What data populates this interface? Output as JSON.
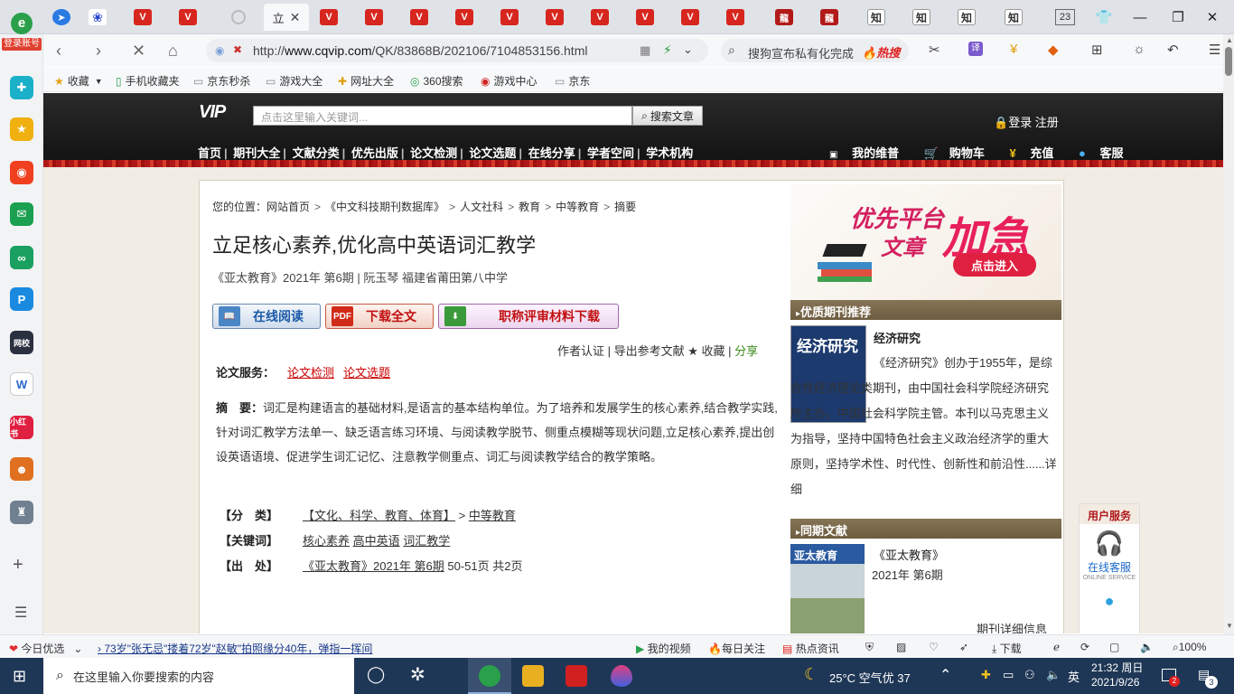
{
  "browser": {
    "tabs": [
      {
        "icon": "compass"
      },
      {
        "icon": "baidu"
      },
      {
        "icon": "cqvip"
      },
      {
        "icon": "cqvip"
      },
      {
        "icon": "loading",
        "label": "立",
        "active": true
      },
      {
        "icon": "cqvip"
      },
      {
        "icon": "cqvip"
      },
      {
        "icon": "cqvip"
      },
      {
        "icon": "cqvip"
      },
      {
        "icon": "cqvip"
      },
      {
        "icon": "cqvip"
      },
      {
        "icon": "cqvip"
      },
      {
        "icon": "cqvip"
      },
      {
        "icon": "cqvip"
      },
      {
        "icon": "cqvip"
      },
      {
        "icon": "cqvip"
      },
      {
        "icon": "dark"
      },
      {
        "icon": "dark"
      },
      {
        "icon": "zhihu",
        "label": "知"
      },
      {
        "icon": "zhihu",
        "label": "知"
      },
      {
        "icon": "zhihu",
        "label": "知"
      },
      {
        "icon": "zhihu",
        "label": "知"
      }
    ],
    "tab_count": "23",
    "url_prefix": "http://",
    "url_host": "www.cqvip.com",
    "url_path": "/QK/83868B/202106/7104853156.html",
    "search_text": "搜狗宣布私有化完成",
    "hot_search": "热搜",
    "login_label": "登录账号",
    "bookmarks": [
      "收藏",
      "手机收藏夹",
      "京东秒杀",
      "游戏大全",
      "网址大全",
      "360搜索",
      "游戏中心",
      "京东"
    ]
  },
  "site": {
    "logo": "VIP",
    "search_placeholder": "点击这里输入关键词...",
    "search_button": "搜索文章",
    "login": "登录 注册",
    "nav": [
      "首页",
      "期刊大全",
      "文献分类",
      "优先出版",
      "论文检测",
      "论文选题",
      "在线分享",
      "学者空间",
      "学术机构"
    ],
    "user_nav": [
      "我的维普",
      "购物车",
      "充值",
      "客服"
    ]
  },
  "article": {
    "breadcrumb_prefix": "您的位置：",
    "breadcrumb": [
      "网站首页",
      "《中文科技期刊数据库》",
      "人文社科",
      "教育",
      "中等教育",
      "摘要"
    ],
    "title": "立足核心素养,优化高中英语词汇教学",
    "meta": "《亚太教育》2021年 第6期 | 阮玉琴   福建省莆田第八中学",
    "buttons": {
      "read": "在线阅读",
      "download": "下载全文",
      "title_material": "职称评审材料下载"
    },
    "actions": {
      "author": "作者认证",
      "sep": " | ",
      "export": "导出参考文献",
      "fav": " ★ 收藏",
      "share": "分享"
    },
    "services_label": "论文服务：",
    "services": [
      "论文检测",
      "论文选题"
    ],
    "abstract_label": "摘　要：",
    "abstract": "词汇是构建语言的基础材料,是语言的基本结构单位。为了培养和发展学生的核心素养,结合教学实践,针对词汇教学方法单一、缺乏语言练习环境、与阅读教学脱节、侧重点模糊等现状问题,立足核心素养,提出创设英语语境、促进学生词汇记忆、注意教学侧重点、词汇与阅读教学结合的教学策略。",
    "fields": [
      {
        "label": "【分　类】",
        "links": [
          "【文化、科学、教育、体育】"
        ],
        "sep": " > ",
        "links2": [
          "中等教育"
        ],
        "extra": ""
      },
      {
        "label": "【关键词】",
        "links": [
          "核心素养",
          "高中英语",
          "词汇教学"
        ],
        "sep": "",
        "links2": [],
        "extra": ""
      },
      {
        "label": "【出　处】",
        "links": [
          "《亚太教育》2021年 第6期"
        ],
        "sep": "",
        "links2": [],
        "extra": " 50-51页 共2页"
      }
    ]
  },
  "sidebar": {
    "ad": {
      "line1": "优先平台",
      "line2": "文章",
      "big": "加急",
      "button": "点击进入"
    },
    "featured_head": "优质期刊推荐",
    "featured_cover_title": "经济研究",
    "featured_name": "经济研究",
    "featured_desc": "《经济研究》创办于1955年，是综合性经济理论类期刊，由中国社会科学院经济研究所主办，中国社会科学院主管。本刊以马克思主义为指导，坚持中国特色社会主义政治经济学的重大原则，坚持学术性、时代性、创新性和前沿性......详细",
    "same_head": "同期文献",
    "same_cover_title": "亚太教育",
    "same_name": "《亚太教育》",
    "same_issue": "2021年 第6期",
    "same_more": "期刊详细信息",
    "usersvc_head": "用户服务",
    "usersvc_label": "在线客服",
    "usersvc_sub": "ONLINE SERVICE"
  },
  "statusbar": {
    "today": "今日优选",
    "news": "73岁\"张无忌\"搂着72岁\"赵敏\"拍照缘分40年，弹指一挥间",
    "video": "我的视频",
    "daily": "每日关注",
    "hot": "热点资讯",
    "download": "下载",
    "zoom": "100%"
  },
  "taskbar": {
    "search_placeholder": "在这里输入你要搜索的内容",
    "weather": "25°C 空气优 37",
    "ime": "英",
    "time": "21:32 周日",
    "date": "2021/9/26",
    "notif_count": "3",
    "badge_count": "2"
  }
}
